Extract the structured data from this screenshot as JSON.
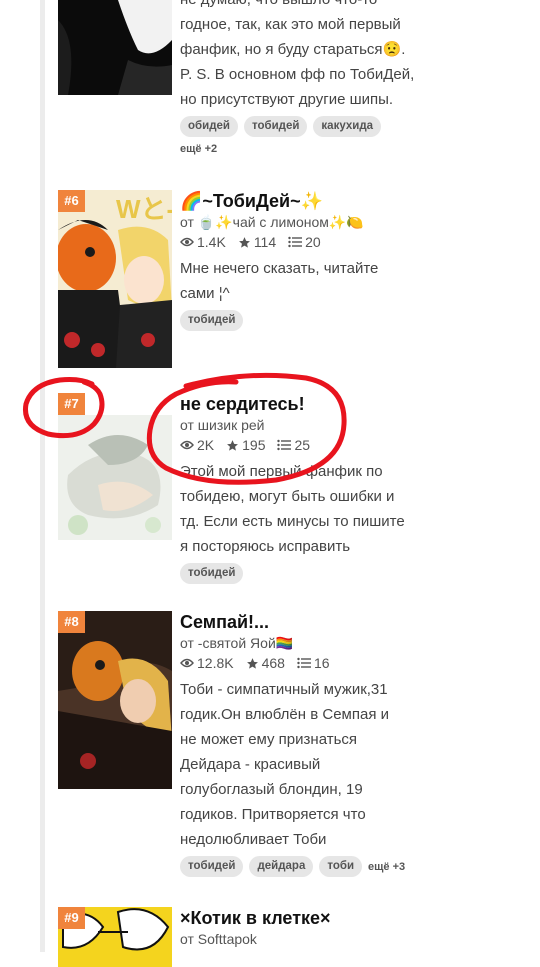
{
  "story_top": {
    "desc_lines": [
      "не думаю, что вышло что-то",
      "годное, так, как это мой первый",
      "фанфик, но я буду стараться😟.",
      "P. S. В основном фф по ТобиДей,",
      "но присутствуют другие шипы."
    ],
    "tags": [
      "обидей",
      "тобидей",
      "какухида"
    ],
    "more": "ещё +2"
  },
  "story6": {
    "rank": "#6",
    "title": "🌈~ТобиДей~✨",
    "author": "от 🍵✨чай с лимоном✨🍋",
    "views": "1.4K",
    "votes": "114",
    "parts": "20",
    "desc_lines": [
      "Мне нечего сказать, читайте",
      "сами ¦^"
    ],
    "tags": [
      "тобидей"
    ]
  },
  "story7": {
    "rank": "#7",
    "title": "не сердитесь!",
    "author": "от шизик рей",
    "views": "2K",
    "votes": "195",
    "parts": "25",
    "desc_lines": [
      "Этой мой первый фанфик по",
      "тобидею, могут быть ошибки и",
      "тд. Если есть минусы то пишите",
      "я посторяюсь исправить"
    ],
    "tags": [
      "тобидей"
    ]
  },
  "story8": {
    "rank": "#8",
    "title": "Семпай!...",
    "author": "от -святой Яой🏳️‍🌈",
    "views": "12.8K",
    "votes": "468",
    "parts": "16",
    "desc_lines": [
      "Тоби - симпатичный мужик,31",
      "годик.Он влюблён в Семпая и",
      "не может ему признаться",
      "Дейдара - красивый",
      "голубоглазый блондин, 19",
      "годиков. Притворяется что",
      "недолюбливает Тоби"
    ],
    "tags": [
      "тобидей",
      "дейдара",
      "тоби"
    ],
    "more": "ещё +3"
  },
  "story9": {
    "rank": "#9",
    "title": "×Котик в клетке×",
    "author": "от Softtapok"
  },
  "colors": {
    "rank_badge": "#f0843c",
    "annotation": "#e8141e",
    "tag_bg": "#e6e6e6"
  }
}
